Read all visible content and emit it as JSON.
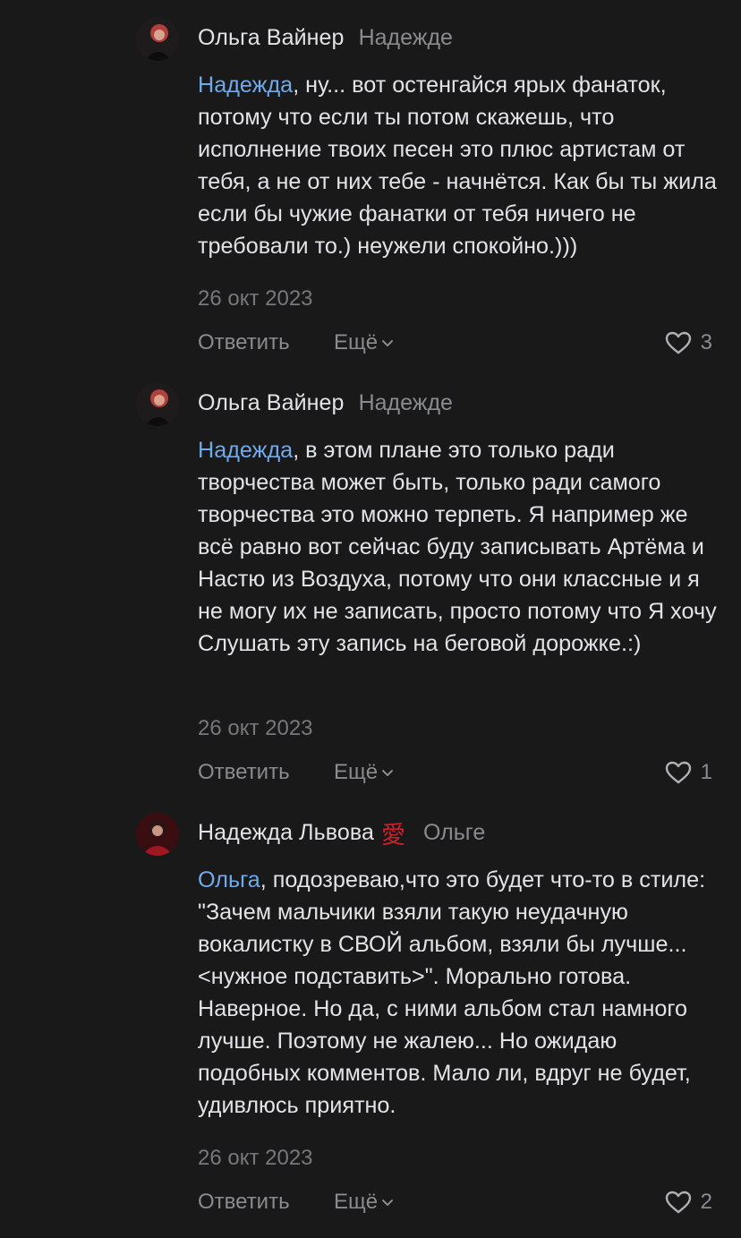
{
  "comments": [
    {
      "author": "Ольга Вайнер",
      "reply_to": "Надежде",
      "mention": "Надежда",
      "text": ", ну... вот остенгайся ярых фанаток, потому что если ты потом скажешь, что исполнение твоих песен это плюс артистам от тебя, а не от них тебе - начнётся. Как бы ты жила если бы чужие фанатки от тебя ничего не требовали то.) неужели спокойно.)))",
      "date": "26 окт 2023",
      "reply_label": "Ответить",
      "more_label": "Ещё",
      "likes": "3",
      "avatar_icon": "user-photo"
    },
    {
      "author": "Ольга Вайнер",
      "reply_to": "Надежде",
      "mention": "Надежда",
      "text": ", в этом плане это только ради творчества может быть, только ради самого творчества это можно терпеть. Я например же всё равно вот сейчас буду записывать Артёма и Настю из Воздуха, потому что они классные и я не могу их не записать, просто потому что Я хочу Слушать эту запись на беговой дорожке.:)",
      "date": "26 окт 2023",
      "reply_label": "Ответить",
      "more_label": "Ещё",
      "likes": "1",
      "avatar_icon": "user-photo"
    },
    {
      "author": "Надежда Львова",
      "badge": "愛",
      "reply_to": "Ольге",
      "mention": "Ольга",
      "text": ", подозреваю,что это будет что-то в стиле: \"Зачем мальчики взяли такую неудачную вокалистку в СВОЙ альбом, взяли бы лучше... <нужное подставить>\". Морально готова. Наверное. Но да, с ними альбом стал намного лучше. Поэтому не жалею... Но ожидаю подобных комментов. Мало ли, вдруг не будет, удивлюсь приятно.",
      "date": "26 окт 2023",
      "reply_label": "Ответить",
      "more_label": "Ещё",
      "likes": "2",
      "avatar_icon": "user-photo"
    }
  ],
  "colors": {
    "background": "#19191a",
    "text": "#e1e3e6",
    "secondary": "#8a8b8e",
    "mention": "#71aaeb",
    "badge": "#c8202b"
  }
}
